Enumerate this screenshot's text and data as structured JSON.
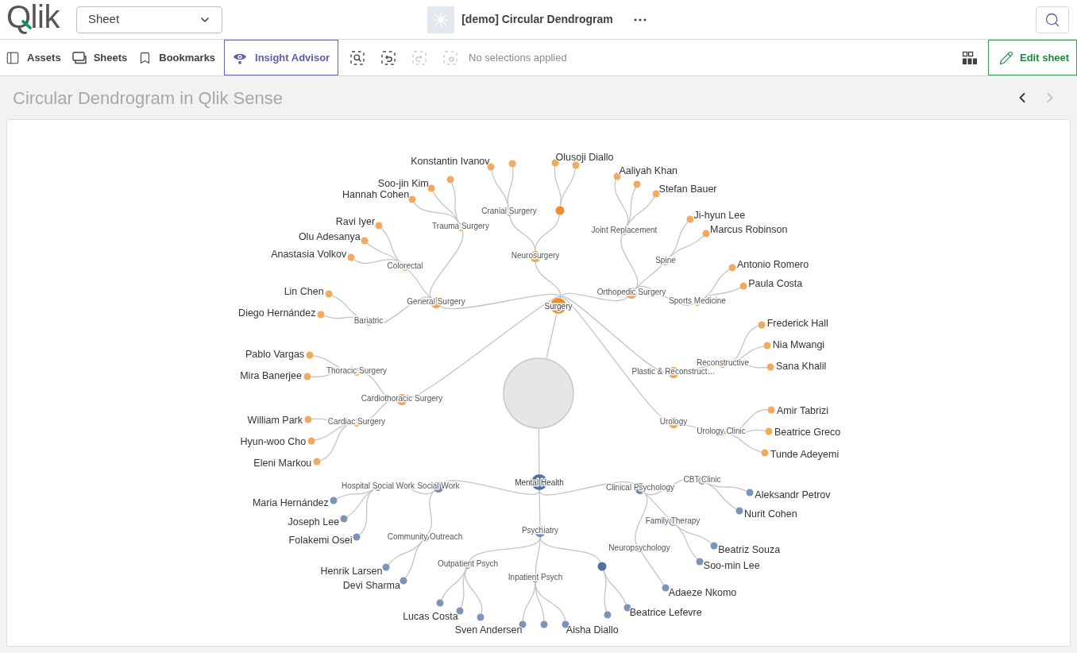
{
  "header": {
    "logo": "Qlik",
    "sheet_dropdown": {
      "value": "Sheet"
    },
    "app_title": "[demo] Circular Dendrogram"
  },
  "toolbar": {
    "nav": [
      {
        "kind": "assets",
        "label": "Assets"
      },
      {
        "kind": "sheets",
        "label": "Sheets"
      },
      {
        "kind": "bookmarks",
        "label": "Bookmarks"
      }
    ],
    "insight_advisor": {
      "label": "Insight Advisor"
    },
    "selection_tools": [
      {
        "kind": "search",
        "disabled": false
      },
      {
        "kind": "back",
        "disabled": false
      },
      {
        "kind": "forward",
        "disabled": true
      },
      {
        "kind": "clear",
        "disabled": true
      }
    ],
    "selections_status": "No selections applied",
    "edit_button": {
      "label": "Edit sheet"
    }
  },
  "sheet": {
    "title": "Circular Dendrogram in Qlik Sense",
    "pager": [
      {
        "kind": "previous",
        "disabled": false
      },
      {
        "kind": "next",
        "disabled": true
      }
    ]
  },
  "dendrogram": {
    "children": [
      {
        "kind": "category",
        "label": "Surgery",
        "color": "#ee8d2b",
        "children": [
          {
            "kind": "branch",
            "label": "General Surgery",
            "children": [
              {
                "kind": "branch",
                "label": "Bariatric",
                "children": [
                  {
                    "kind": "leaf",
                    "label": "Lin Chen"
                  },
                  {
                    "kind": "leaf",
                    "label": "Diego Hernández"
                  }
                ]
              },
              {
                "kind": "branch",
                "label": "Colorectal",
                "children": [
                  {
                    "kind": "leaf",
                    "label": "Ravi Iyer"
                  },
                  {
                    "kind": "leaf",
                    "label": "Olu Adesanya"
                  },
                  {
                    "kind": "leaf",
                    "label": "Anastasia Volkov"
                  }
                ]
              },
              {
                "kind": "branch",
                "label": "Trauma Surgery",
                "children": [
                  {
                    "kind": "leaf"
                  },
                  {
                    "kind": "leaf",
                    "label": "Soo-jin Kim"
                  },
                  {
                    "kind": "leaf",
                    "label": "Hannah Cohen"
                  }
                ]
              }
            ]
          },
          {
            "kind": "branch",
            "label": "Neurosurgery",
            "children": [
              {
                "kind": "branch",
                "label": "Cranial Surgery",
                "children": [
                  {
                    "kind": "leaf",
                    "label": "Konstantin Ivanov"
                  },
                  {
                    "kind": "leaf"
                  }
                ]
              },
              {
                "kind": "branch",
                "children": [
                  {
                    "kind": "leaf",
                    "label": "Olusoji Diallo"
                  },
                  {
                    "kind": "leaf"
                  }
                ]
              }
            ]
          },
          {
            "kind": "branch",
            "label": "Orthopedic Surgery",
            "children": [
              {
                "kind": "branch",
                "label": "Joint Replacement",
                "children": [
                  {
                    "kind": "leaf",
                    "label": "Aaliyah Khan"
                  },
                  {
                    "kind": "leaf"
                  },
                  {
                    "kind": "leaf",
                    "label": "Stefan Bauer"
                  }
                ]
              },
              {
                "kind": "branch",
                "label": "Spine",
                "children": [
                  {
                    "kind": "leaf",
                    "label": "Ji-hyun Lee"
                  },
                  {
                    "kind": "leaf",
                    "label": "Marcus Robinson"
                  }
                ]
              },
              {
                "kind": "branch",
                "label": "Sports Medicine",
                "children": [
                  {
                    "kind": "leaf",
                    "label": "Antonio Romero"
                  },
                  {
                    "kind": "leaf",
                    "label": "Paula Costa"
                  }
                ]
              }
            ]
          },
          {
            "kind": "branch",
            "label": "Plastic & Reconstruct…",
            "children": [
              {
                "kind": "branch",
                "label": "Reconstructive",
                "children": [
                  {
                    "kind": "leaf",
                    "label": "Frederick Hall"
                  },
                  {
                    "kind": "leaf",
                    "label": "Nia Mwangi"
                  },
                  {
                    "kind": "leaf",
                    "label": "Sana Khalil"
                  }
                ]
              }
            ]
          },
          {
            "kind": "branch",
            "label": "Urology",
            "children": [
              {
                "kind": "branch",
                "label": "Urology Clinic",
                "children": [
                  {
                    "kind": "leaf",
                    "label": "Amir Tabrizi"
                  },
                  {
                    "kind": "leaf",
                    "label": "Beatrice Greco"
                  },
                  {
                    "kind": "leaf",
                    "label": "Tunde Adeyemi"
                  }
                ]
              }
            ]
          },
          {
            "kind": "branch",
            "label": "Cardiothoracic Surgery",
            "children": [
              {
                "kind": "branch",
                "label": "Thoracic Surgery",
                "children": [
                  {
                    "kind": "leaf",
                    "label": "Pablo Vargas"
                  },
                  {
                    "kind": "leaf",
                    "label": "Mira Banerjee"
                  }
                ]
              },
              {
                "kind": "branch",
                "label": "Cardiac Surgery",
                "children": [
                  {
                    "kind": "leaf",
                    "label": "William Park"
                  },
                  {
                    "kind": "leaf",
                    "label": "Hyun-woo Cho"
                  },
                  {
                    "kind": "leaf",
                    "label": "Eleni Markou"
                  }
                ]
              }
            ]
          }
        ]
      },
      {
        "kind": "category",
        "label": "Mental Health",
        "color": "#4e70a3",
        "children": [
          {
            "kind": "branch",
            "label": "Social Work",
            "children": [
              {
                "kind": "branch",
                "label": "Hospital Social Work",
                "children": [
                  {
                    "kind": "leaf",
                    "label": "Maria Hernández"
                  },
                  {
                    "kind": "leaf",
                    "label": "Joseph Lee"
                  },
                  {
                    "kind": "leaf",
                    "label": "Folakemi Osei"
                  }
                ]
              },
              {
                "kind": "branch",
                "label": "Community Outreach",
                "children": [
                  {
                    "kind": "leaf",
                    "label": "Henrik Larsen"
                  },
                  {
                    "kind": "leaf",
                    "label": "Devi Sharma"
                  }
                ]
              }
            ]
          },
          {
            "kind": "branch",
            "label": "Psychiatry",
            "children": [
              {
                "kind": "branch",
                "label": "Outpatient Psych",
                "children": [
                  {
                    "kind": "leaf"
                  },
                  {
                    "kind": "leaf",
                    "label": "Lucas Costa"
                  },
                  {
                    "kind": "leaf"
                  }
                ]
              },
              {
                "kind": "branch",
                "label": "Inpatient Psych",
                "children": [
                  {
                    "kind": "leaf",
                    "label": "Sven Andersen"
                  },
                  {
                    "kind": "leaf"
                  },
                  {
                    "kind": "leaf",
                    "label": "Aisha Diallo"
                  }
                ]
              },
              {
                "kind": "branch",
                "children": [
                  {
                    "kind": "leaf"
                  },
                  {
                    "kind": "leaf",
                    "label": "Beatrice Lefevre"
                  }
                ]
              }
            ]
          },
          {
            "kind": "branch",
            "label": "Clinical Psychology",
            "children": [
              {
                "kind": "branch",
                "label": "CBT Clinic",
                "children": [
                  {
                    "kind": "leaf",
                    "label": "Aleksandr Petrov"
                  },
                  {
                    "kind": "leaf",
                    "label": "Nurit Cohen"
                  }
                ]
              },
              {
                "kind": "branch",
                "label": "Family Therapy",
                "children": [
                  {
                    "kind": "leaf",
                    "label": "Beatriz Souza"
                  },
                  {
                    "kind": "leaf",
                    "label": "Soo-min Lee"
                  }
                ]
              },
              {
                "kind": "branch",
                "label": "Neuropsychology",
                "children": [
                  {
                    "kind": "leaf",
                    "label": "Adaeze Nkomo"
                  }
                ]
              }
            ]
          }
        ]
      }
    ]
  }
}
